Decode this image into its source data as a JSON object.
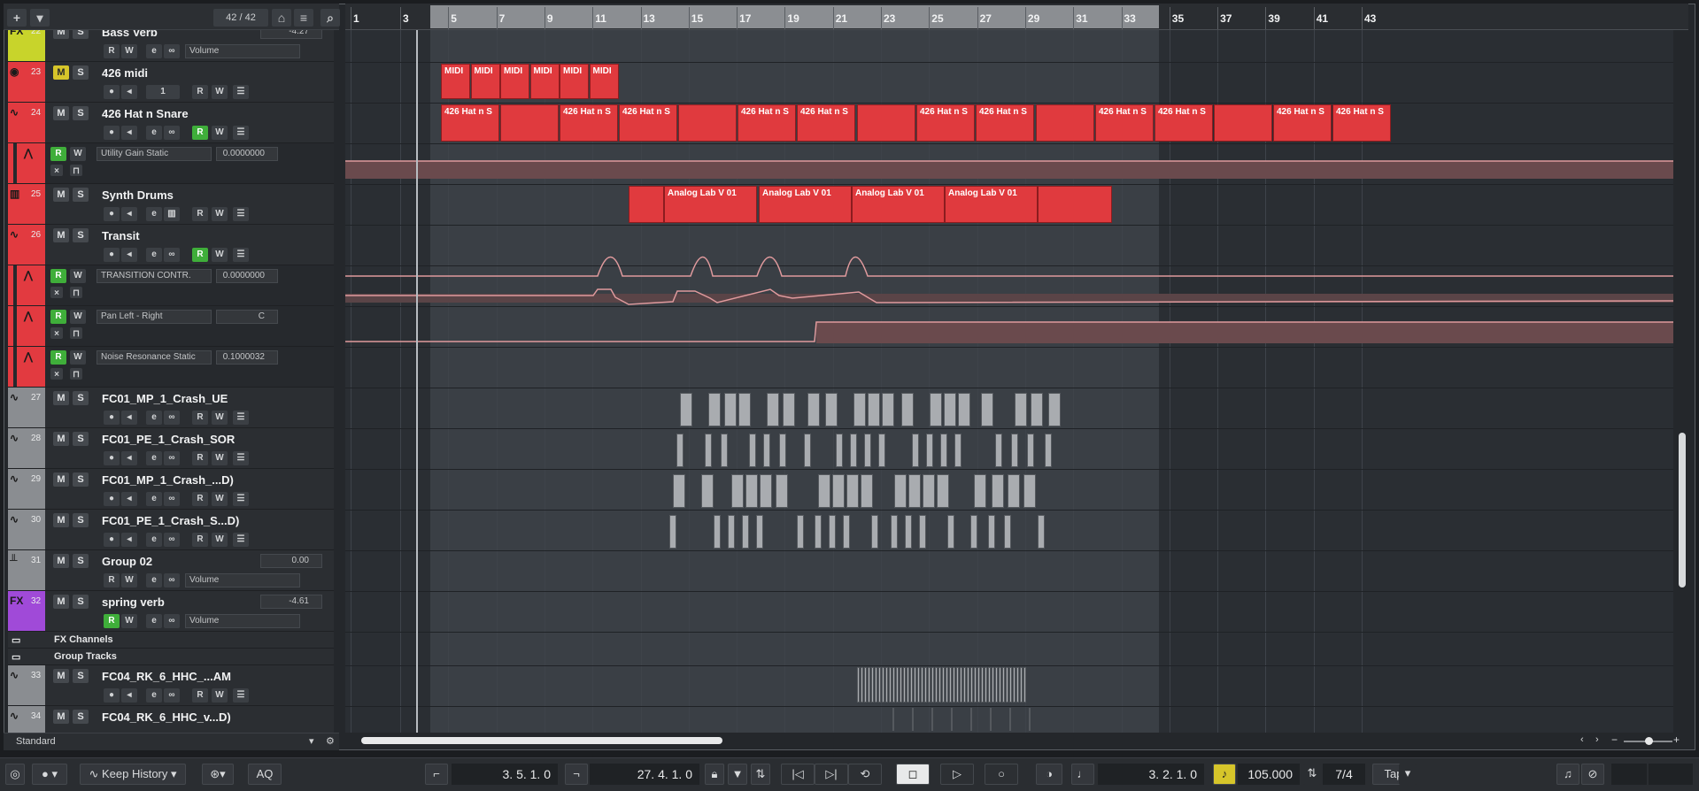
{
  "header": {
    "track_counter": "42 / 42",
    "add_track_icon": "plus-icon",
    "search_icon": "search-icon"
  },
  "tracks": [
    {
      "num": "22",
      "name": "Bass Verb",
      "type_icon": "FX",
      "color": "#c8d42b",
      "value": "-4.27",
      "dropdown": "Volume"
    },
    {
      "num": "23",
      "name": "426 midi",
      "color": "#e23a40",
      "channel": "1",
      "mute_on": true
    },
    {
      "num": "24",
      "name": "426 Hat n Snare",
      "color": "#e23a40"
    },
    {
      "auto": true,
      "param": "Utility Gain Static",
      "value": "0.0000000",
      "color": "#e23a40"
    },
    {
      "num": "25",
      "name": "Synth Drums",
      "color": "#e23a40"
    },
    {
      "num": "26",
      "name": "Transit",
      "color": "#e23a40"
    },
    {
      "auto": true,
      "param": "TRANSITION CONTR.",
      "value": "0.0000000",
      "color": "#e23a40"
    },
    {
      "auto": true,
      "param": "Pan Left - Right",
      "value": "C",
      "color": "#e23a40"
    },
    {
      "auto": true,
      "param": "Noise Resonance Static",
      "value": "0.1000032",
      "color": "#e23a40"
    },
    {
      "num": "27",
      "name": "FC01_MP_1_Crash_UE",
      "color": "#8a8d91"
    },
    {
      "num": "28",
      "name": "FC01_PE_1_Crash_SOR",
      "color": "#8a8d91"
    },
    {
      "num": "29",
      "name": "FC01_MP_1_Crash_...D)",
      "color": "#8a8d91"
    },
    {
      "num": "30",
      "name": "FC01_PE_1_Crash_S...D)",
      "color": "#8a8d91"
    },
    {
      "num": "31",
      "name": "Group 02",
      "color": "#8a8d91",
      "value": "0.00",
      "dropdown": "Volume"
    },
    {
      "num": "32",
      "name": "spring verb",
      "type_icon": "FX",
      "color": "#a04ad8",
      "value": "-4.61",
      "dropdown": "Volume"
    }
  ],
  "folders": [
    {
      "name": "FX Channels"
    },
    {
      "name": "Group Tracks"
    }
  ],
  "tracks_bottom": [
    {
      "num": "33",
      "name": "FC04_RK_6_HHC_...AM",
      "color": "#8a8d91"
    },
    {
      "num": "34",
      "name": "FC04_RK_6_HHC_v...D)",
      "color": "#8a8d91"
    }
  ],
  "buttons": {
    "mute": "M",
    "solo": "S",
    "read": "R",
    "write": "W"
  },
  "footer": {
    "view_label": "Standard"
  },
  "ruler": {
    "bars": [
      "1",
      "3",
      "5",
      "7",
      "9",
      "11",
      "13",
      "15",
      "17",
      "19",
      "21",
      "23",
      "25",
      "27",
      "29",
      "31",
      "33",
      "35",
      "37",
      "39",
      "41",
      "43"
    ]
  },
  "events": {
    "midi_label": "MIDI",
    "hat_label": "426 Hat n S",
    "analog_label": "Analog Lab V 01"
  },
  "transport": {
    "keep_history": "Keep History",
    "aq": "AQ",
    "left_locator": "3. 5. 1.   0",
    "right_locator": "27. 4. 1.   0",
    "position": "3. 2. 1.   0",
    "tempo": "105.000",
    "signature": "7/4",
    "tap": "Tap"
  }
}
